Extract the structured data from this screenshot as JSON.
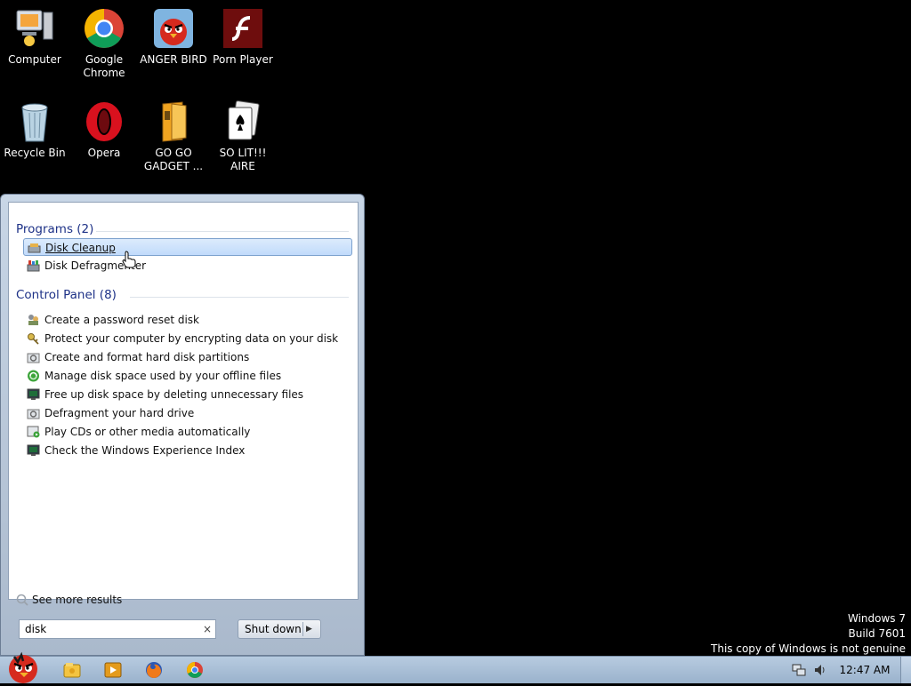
{
  "desktop": {
    "icons": [
      {
        "label_1": "Computer",
        "label_2": "",
        "icon": "computer-icon"
      },
      {
        "label_1": "Google",
        "label_2": "Chrome",
        "icon": "chrome-icon"
      },
      {
        "label_1": "ANGER BIRD",
        "label_2": "",
        "icon": "angry-bird-icon"
      },
      {
        "label_1": "Porn Player",
        "label_2": "",
        "icon": "flash-icon"
      },
      {
        "label_1": "Recycle Bin",
        "label_2": "",
        "icon": "recycle-bin-icon"
      },
      {
        "label_1": "Opera",
        "label_2": "",
        "icon": "opera-icon"
      },
      {
        "label_1": "GO GO",
        "label_2": "GADGET ...",
        "icon": "folder-icon"
      },
      {
        "label_1": "SO LIT!!! AIRE",
        "label_2": "",
        "icon": "cards-icon"
      }
    ]
  },
  "start_menu": {
    "programs_title": "Programs (2)",
    "programs": [
      {
        "label": "Disk Cleanup",
        "icon": "disk-cleanup-icon"
      },
      {
        "label": "Disk Defragmenter",
        "icon": "disk-defrag-icon"
      }
    ],
    "control_panel_title": "Control Panel (8)",
    "control_panel": [
      {
        "label": "Create a password reset disk",
        "icon": "users-icon"
      },
      {
        "label": "Protect your computer by encrypting data on your disk",
        "icon": "keys-icon"
      },
      {
        "label": "Create and format hard disk partitions",
        "icon": "admin-tools-icon"
      },
      {
        "label": "Manage disk space used by your offline files",
        "icon": "sync-icon"
      },
      {
        "label": "Free up disk space by deleting unnecessary files",
        "icon": "monitor-icon"
      },
      {
        "label": "Defragment your hard drive",
        "icon": "admin-tools-icon"
      },
      {
        "label": "Play CDs or other media automatically",
        "icon": "autoplay-icon"
      },
      {
        "label": "Check the Windows Experience Index",
        "icon": "monitor-icon"
      }
    ],
    "see_more": "See more results",
    "search_value": "disk",
    "search_clear": "×",
    "shutdown_label": "Shut down"
  },
  "taskbar": {
    "clock": "12:47 AM",
    "buttons": [
      "explorer-icon",
      "media-player-icon",
      "firefox-icon",
      "chrome-icon"
    ]
  },
  "watermark": {
    "line1": "Windows 7",
    "line2": "Build 7601",
    "line3": "This copy of Windows is not genuine"
  }
}
